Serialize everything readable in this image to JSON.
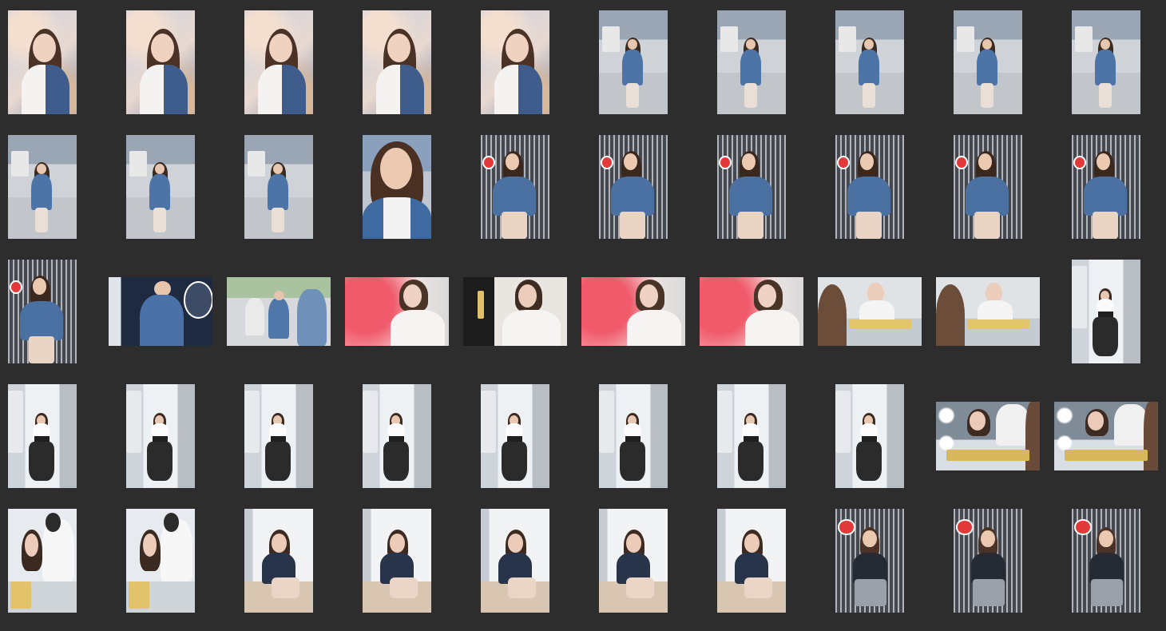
{
  "gallery": {
    "background": "#2d2d2d",
    "highlight": "#3b82f6",
    "thumbnails": [
      {
        "scene": "soft-bokeh-portrait"
      },
      {
        "scene": "soft-bokeh-portrait"
      },
      {
        "scene": "soft-bokeh-portrait"
      },
      {
        "scene": "soft-bokeh-portrait"
      },
      {
        "scene": "soft-bokeh-portrait"
      },
      {
        "scene": "street-walk-denim"
      },
      {
        "scene": "street-walk-denim"
      },
      {
        "scene": "street-walk-denim"
      },
      {
        "scene": "street-walk-denim"
      },
      {
        "scene": "street-walk-denim"
      },
      {
        "scene": "street-walk-denim"
      },
      {
        "scene": "street-walk-denim"
      },
      {
        "scene": "street-walk-denim"
      },
      {
        "scene": "street-closeup-denim"
      },
      {
        "scene": "stage-seated-denim"
      },
      {
        "scene": "stage-seated-denim"
      },
      {
        "scene": "stage-seated-denim"
      },
      {
        "scene": "stage-seated-denim"
      },
      {
        "scene": "stage-seated-denim"
      },
      {
        "scene": "stage-seated-denim"
      },
      {
        "scene": "stage-seated-denim"
      },
      {
        "scene": "logo-wall-denim"
      },
      {
        "scene": "street-group"
      },
      {
        "scene": "pink-bokeh-phone"
      },
      {
        "scene": "backstage-phone"
      },
      {
        "scene": "pink-bokeh-phone"
      },
      {
        "scene": "pink-bokeh-phone"
      },
      {
        "scene": "makeup-table"
      },
      {
        "scene": "makeup-table"
      },
      {
        "scene": "alley-dress"
      },
      {
        "scene": "alley-dress"
      },
      {
        "scene": "alley-dress"
      },
      {
        "scene": "alley-dress"
      },
      {
        "scene": "alley-dress"
      },
      {
        "scene": "alley-dress"
      },
      {
        "scene": "alley-dress"
      },
      {
        "scene": "alley-dress"
      },
      {
        "scene": "alley-dress"
      },
      {
        "scene": "makeup-mirror"
      },
      {
        "scene": "makeup-mirror"
      },
      {
        "scene": "makeup-artist"
      },
      {
        "scene": "makeup-artist"
      },
      {
        "scene": "white-wall-seated"
      },
      {
        "scene": "white-wall-seated"
      },
      {
        "scene": "white-wall-seated"
      },
      {
        "scene": "white-wall-seated"
      },
      {
        "scene": "white-wall-seated"
      },
      {
        "scene": "stage-seated-dark"
      },
      {
        "scene": "stage-seated-dark"
      },
      {
        "scene": "stage-seated-dark"
      }
    ]
  }
}
